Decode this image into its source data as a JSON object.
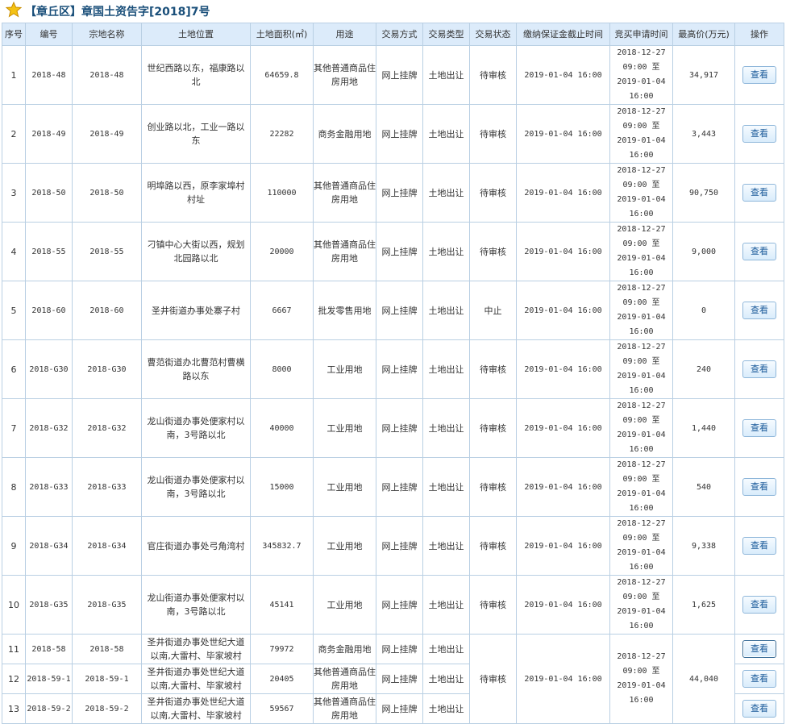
{
  "page_title": "【章丘区】章国土资告字[2018]7号",
  "columns": [
    "序号",
    "编号",
    "宗地名称",
    "土地位置",
    "土地面积(㎡)",
    "用途",
    "交易方式",
    "交易类型",
    "交易状态",
    "缴纳保证金截止时间",
    "竞买申请时间",
    "最高价(万元)",
    "操作"
  ],
  "rows": [
    {
      "no": "1",
      "code": "2018-48",
      "name": "2018-48",
      "location": "世纪西路以东，福康路以北",
      "area": "64659.8",
      "use": "其他普通商品住房用地",
      "method": "网上挂牌",
      "type": "土地出让",
      "status": "待审核",
      "deposit_deadline": "2019-01-04 16:00",
      "apply_time": "2018-12-27 09:00 至 2019-01-04 16:00",
      "price": "34,917",
      "action": "查看"
    },
    {
      "no": "2",
      "code": "2018-49",
      "name": "2018-49",
      "location": "创业路以北，工业一路以东",
      "area": "22282",
      "use": "商务金融用地",
      "method": "网上挂牌",
      "type": "土地出让",
      "status": "待审核",
      "deposit_deadline": "2019-01-04 16:00",
      "apply_time": "2018-12-27 09:00 至 2019-01-04 16:00",
      "price": "3,443",
      "action": "查看"
    },
    {
      "no": "3",
      "code": "2018-50",
      "name": "2018-50",
      "location": "明埠路以西，原李家埠村村址",
      "area": "110000",
      "use": "其他普通商品住房用地",
      "method": "网上挂牌",
      "type": "土地出让",
      "status": "待审核",
      "deposit_deadline": "2019-01-04 16:00",
      "apply_time": "2018-12-27 09:00 至 2019-01-04 16:00",
      "price": "90,750",
      "action": "查看"
    },
    {
      "no": "4",
      "code": "2018-55",
      "name": "2018-55",
      "location": "刁镇中心大街以西，规划北园路以北",
      "area": "20000",
      "use": "其他普通商品住房用地",
      "method": "网上挂牌",
      "type": "土地出让",
      "status": "待审核",
      "deposit_deadline": "2019-01-04 16:00",
      "apply_time": "2018-12-27 09:00 至 2019-01-04 16:00",
      "price": "9,000",
      "action": "查看"
    },
    {
      "no": "5",
      "code": "2018-60",
      "name": "2018-60",
      "location": "圣井街道办事处寨子村",
      "area": "6667",
      "use": "批发零售用地",
      "method": "网上挂牌",
      "type": "土地出让",
      "status": "中止",
      "deposit_deadline": "2019-01-04 16:00",
      "apply_time": "2018-12-27 09:00 至 2019-01-04 16:00",
      "price": "0",
      "action": "查看"
    },
    {
      "no": "6",
      "code": "2018-G30",
      "name": "2018-G30",
      "location": "曹范街道办北曹范村曹横路以东",
      "area": "8000",
      "use": "工业用地",
      "method": "网上挂牌",
      "type": "土地出让",
      "status": "待审核",
      "deposit_deadline": "2019-01-04 16:00",
      "apply_time": "2018-12-27 09:00 至 2019-01-04 16:00",
      "price": "240",
      "action": "查看"
    },
    {
      "no": "7",
      "code": "2018-G32",
      "name": "2018-G32",
      "location": "龙山街道办事处便家村以南，3号路以北",
      "area": "40000",
      "use": "工业用地",
      "method": "网上挂牌",
      "type": "土地出让",
      "status": "待审核",
      "deposit_deadline": "2019-01-04 16:00",
      "apply_time": "2018-12-27 09:00 至 2019-01-04 16:00",
      "price": "1,440",
      "action": "查看"
    },
    {
      "no": "8",
      "code": "2018-G33",
      "name": "2018-G33",
      "location": "龙山街道办事处便家村以南，3号路以北",
      "area": "15000",
      "use": "工业用地",
      "method": "网上挂牌",
      "type": "土地出让",
      "status": "待审核",
      "deposit_deadline": "2019-01-04 16:00",
      "apply_time": "2018-12-27 09:00 至 2019-01-04 16:00",
      "price": "540",
      "action": "查看"
    },
    {
      "no": "9",
      "code": "2018-G34",
      "name": "2018-G34",
      "location": "官庄街道办事处弓角湾村",
      "area": "345832.7",
      "use": "工业用地",
      "method": "网上挂牌",
      "type": "土地出让",
      "status": "待审核",
      "deposit_deadline": "2019-01-04 16:00",
      "apply_time": "2018-12-27 09:00 至 2019-01-04 16:00",
      "price": "9,338",
      "action": "查看"
    },
    {
      "no": "10",
      "code": "2018-G35",
      "name": "2018-G35",
      "location": "龙山街道办事处便家村以南，3号路以北",
      "area": "45141",
      "use": "工业用地",
      "method": "网上挂牌",
      "type": "土地出让",
      "status": "待审核",
      "deposit_deadline": "2019-01-04 16:00",
      "apply_time": "2018-12-27 09:00 至 2019-01-04 16:00",
      "price": "1,625",
      "action": "查看"
    }
  ],
  "group": {
    "status": "待审核",
    "deposit_deadline": "2019-01-04 16:00",
    "apply_time": "2018-12-27 09:00 至 2019-01-04 16:00",
    "price": "44,040",
    "rows": [
      {
        "no": "11",
        "code": "2018-58",
        "name": "2018-58",
        "location": "圣井街道办事处世纪大道以南,大雷村、毕家坡村",
        "area": "79972",
        "use": "商务金融用地",
        "method": "网上挂牌",
        "type": "土地出让",
        "action": "查看"
      },
      {
        "no": "12",
        "code": "2018-59-1",
        "name": "2018-59-1",
        "location": "圣井街道办事处世纪大道以南,大雷村、毕家坡村",
        "area": "20405",
        "use": "其他普通商品住房用地",
        "method": "网上挂牌",
        "type": "土地出让",
        "action": "查看"
      },
      {
        "no": "13",
        "code": "2018-59-2",
        "name": "2018-59-2",
        "location": "圣井街道办事处世纪大道以南,大雷村、毕家坡村",
        "area": "59567",
        "use": "其他普通商品住房用地",
        "method": "网上挂牌",
        "type": "土地出让",
        "action": "查看"
      }
    ]
  }
}
